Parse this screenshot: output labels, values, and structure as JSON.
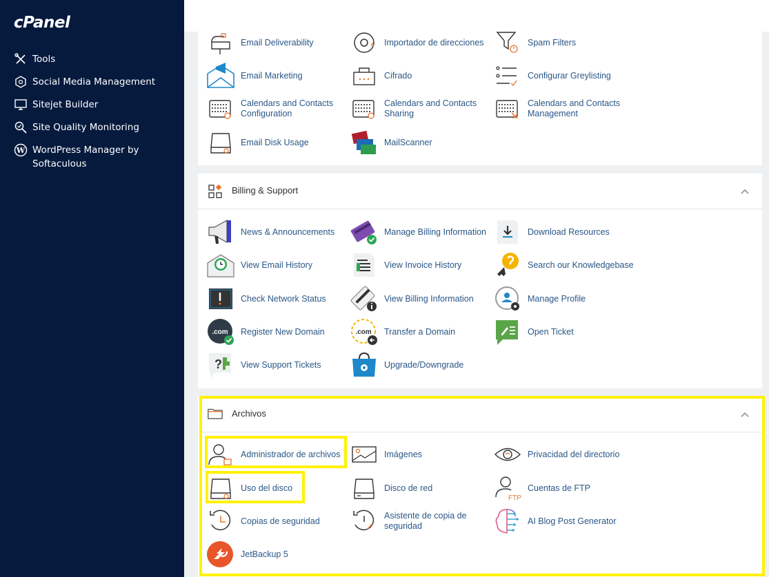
{
  "brand": {
    "logo": "cPanel"
  },
  "sidebar": {
    "items": [
      {
        "label": "Tools",
        "icon": "tools-icon"
      },
      {
        "label": "Social Media Management",
        "icon": "social-icon"
      },
      {
        "label": "Sitejet Builder",
        "icon": "monitor-icon"
      },
      {
        "label": "Site Quality Monitoring",
        "icon": "magnify-icon"
      },
      {
        "label": "WordPress Manager by Softaculous",
        "icon": "wordpress-icon"
      }
    ]
  },
  "email_section": {
    "items": [
      {
        "label": "Email Deliverability"
      },
      {
        "label": "Importador de direcciones"
      },
      {
        "label": "Spam Filters"
      },
      {
        "label": "Email Marketing"
      },
      {
        "label": "Cifrado"
      },
      {
        "label": "Configurar Greylisting"
      },
      {
        "label": "Calendars and Contacts Configuration"
      },
      {
        "label": "Calendars and Contacts Sharing"
      },
      {
        "label": "Calendars and Contacts Management"
      },
      {
        "label": "Email Disk Usage"
      },
      {
        "label": "MailScanner"
      }
    ]
  },
  "billing_section": {
    "title": "Billing & Support",
    "items": [
      {
        "label": "News & Announcements"
      },
      {
        "label": "Manage Billing Information"
      },
      {
        "label": "Download Resources"
      },
      {
        "label": "View Email History"
      },
      {
        "label": "View Invoice History"
      },
      {
        "label": "Search our Knowledgebase"
      },
      {
        "label": "Check Network Status"
      },
      {
        "label": "View Billing Information"
      },
      {
        "label": "Manage Profile"
      },
      {
        "label": "Register New Domain"
      },
      {
        "label": "Transfer a Domain"
      },
      {
        "label": "Open Ticket"
      },
      {
        "label": "View Support Tickets"
      },
      {
        "label": "Upgrade/Downgrade"
      }
    ]
  },
  "files_section": {
    "title": "Archivos",
    "items": [
      {
        "label": "Administrador de archivos"
      },
      {
        "label": "Imágenes"
      },
      {
        "label": "Privacidad del directorio"
      },
      {
        "label": "Uso del disco"
      },
      {
        "label": "Disco de red"
      },
      {
        "label": "Cuentas de FTP"
      },
      {
        "label": "Copias de seguridad"
      },
      {
        "label": "Asistente de copia de seguridad"
      },
      {
        "label": "AI Blog Post Generator"
      },
      {
        "label": "JetBackup 5"
      }
    ]
  },
  "colors": {
    "sidebar_bg": "#061a3e",
    "link": "#2a5787",
    "highlight": "#fff200",
    "accent_orange": "#e8742c"
  }
}
